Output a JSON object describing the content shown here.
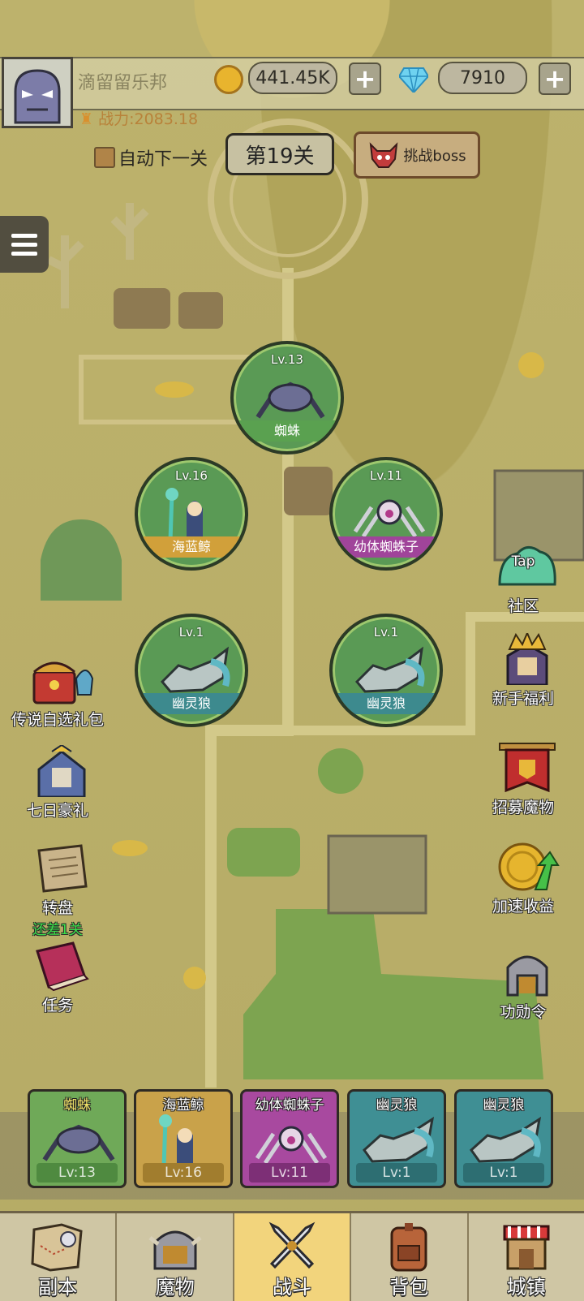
{
  "player": {
    "name": "滴留留乐邦",
    "power": "战力:2083.18"
  },
  "currency": {
    "gold": "441.45K",
    "gems": "7910"
  },
  "battle_controls": {
    "auto_next_label": "自动下一关",
    "stage_label": "第19关",
    "boss_label": "挑战boss"
  },
  "formation": [
    {
      "name": "蜘蛛",
      "level": "Lv.13",
      "color": "#5aa150"
    },
    {
      "name": "海蓝鲸",
      "level": "Lv.16",
      "color": "#d1a03a"
    },
    {
      "name": "幼体蜘蛛子",
      "level": "Lv.11",
      "color": "#a0449a"
    },
    {
      "name": "幽灵狼",
      "level": "Lv.1",
      "color": "#3d8a8e"
    },
    {
      "name": "幽灵狼",
      "level": "Lv.1",
      "color": "#3d8a8e"
    }
  ],
  "left_shortcuts": [
    {
      "label": "传说自选礼包",
      "icon": "treasure-chest-icon"
    },
    {
      "label": "七日豪礼",
      "icon": "knight-icon"
    },
    {
      "label": "转盘",
      "sub": "还差1关",
      "icon": "scroll-icon"
    },
    {
      "label": "任务",
      "icon": "book-icon"
    }
  ],
  "right_shortcuts": [
    {
      "label": "社区",
      "badge": "Tap",
      "icon": "community-icon"
    },
    {
      "label": "新手福利",
      "icon": "king-icon"
    },
    {
      "label": "招募魔物",
      "icon": "banner-icon"
    },
    {
      "label": "加速收益",
      "icon": "coin-speed-icon"
    },
    {
      "label": "功勋令",
      "icon": "helmet-icon"
    }
  ],
  "team": [
    {
      "name": "蜘蛛",
      "level": "Lv:13",
      "bg": "#6fa958",
      "bar": "#4f8a40"
    },
    {
      "name": "海蓝鲸",
      "level": "Lv:16",
      "bg": "#c9a24a",
      "bar": "#a17d2e"
    },
    {
      "name": "幼体蜘蛛子",
      "level": "Lv:11",
      "bg": "#a8499f",
      "bar": "#7d2f76"
    },
    {
      "name": "幽灵狼",
      "level": "Lv:1",
      "bg": "#3f8f94",
      "bar": "#2d6e72"
    },
    {
      "name": "幽灵狼",
      "level": "Lv:1",
      "bg": "#3f8f94",
      "bar": "#2d6e72"
    }
  ],
  "nav": [
    {
      "label": "副本",
      "icon": "map-icon",
      "active": false
    },
    {
      "label": "魔物",
      "icon": "monster-helmet-icon",
      "active": false
    },
    {
      "label": "战斗",
      "icon": "crossed-swords-icon",
      "active": true
    },
    {
      "label": "背包",
      "icon": "backpack-icon",
      "active": false
    },
    {
      "label": "城镇",
      "icon": "shop-icon",
      "active": false
    }
  ]
}
